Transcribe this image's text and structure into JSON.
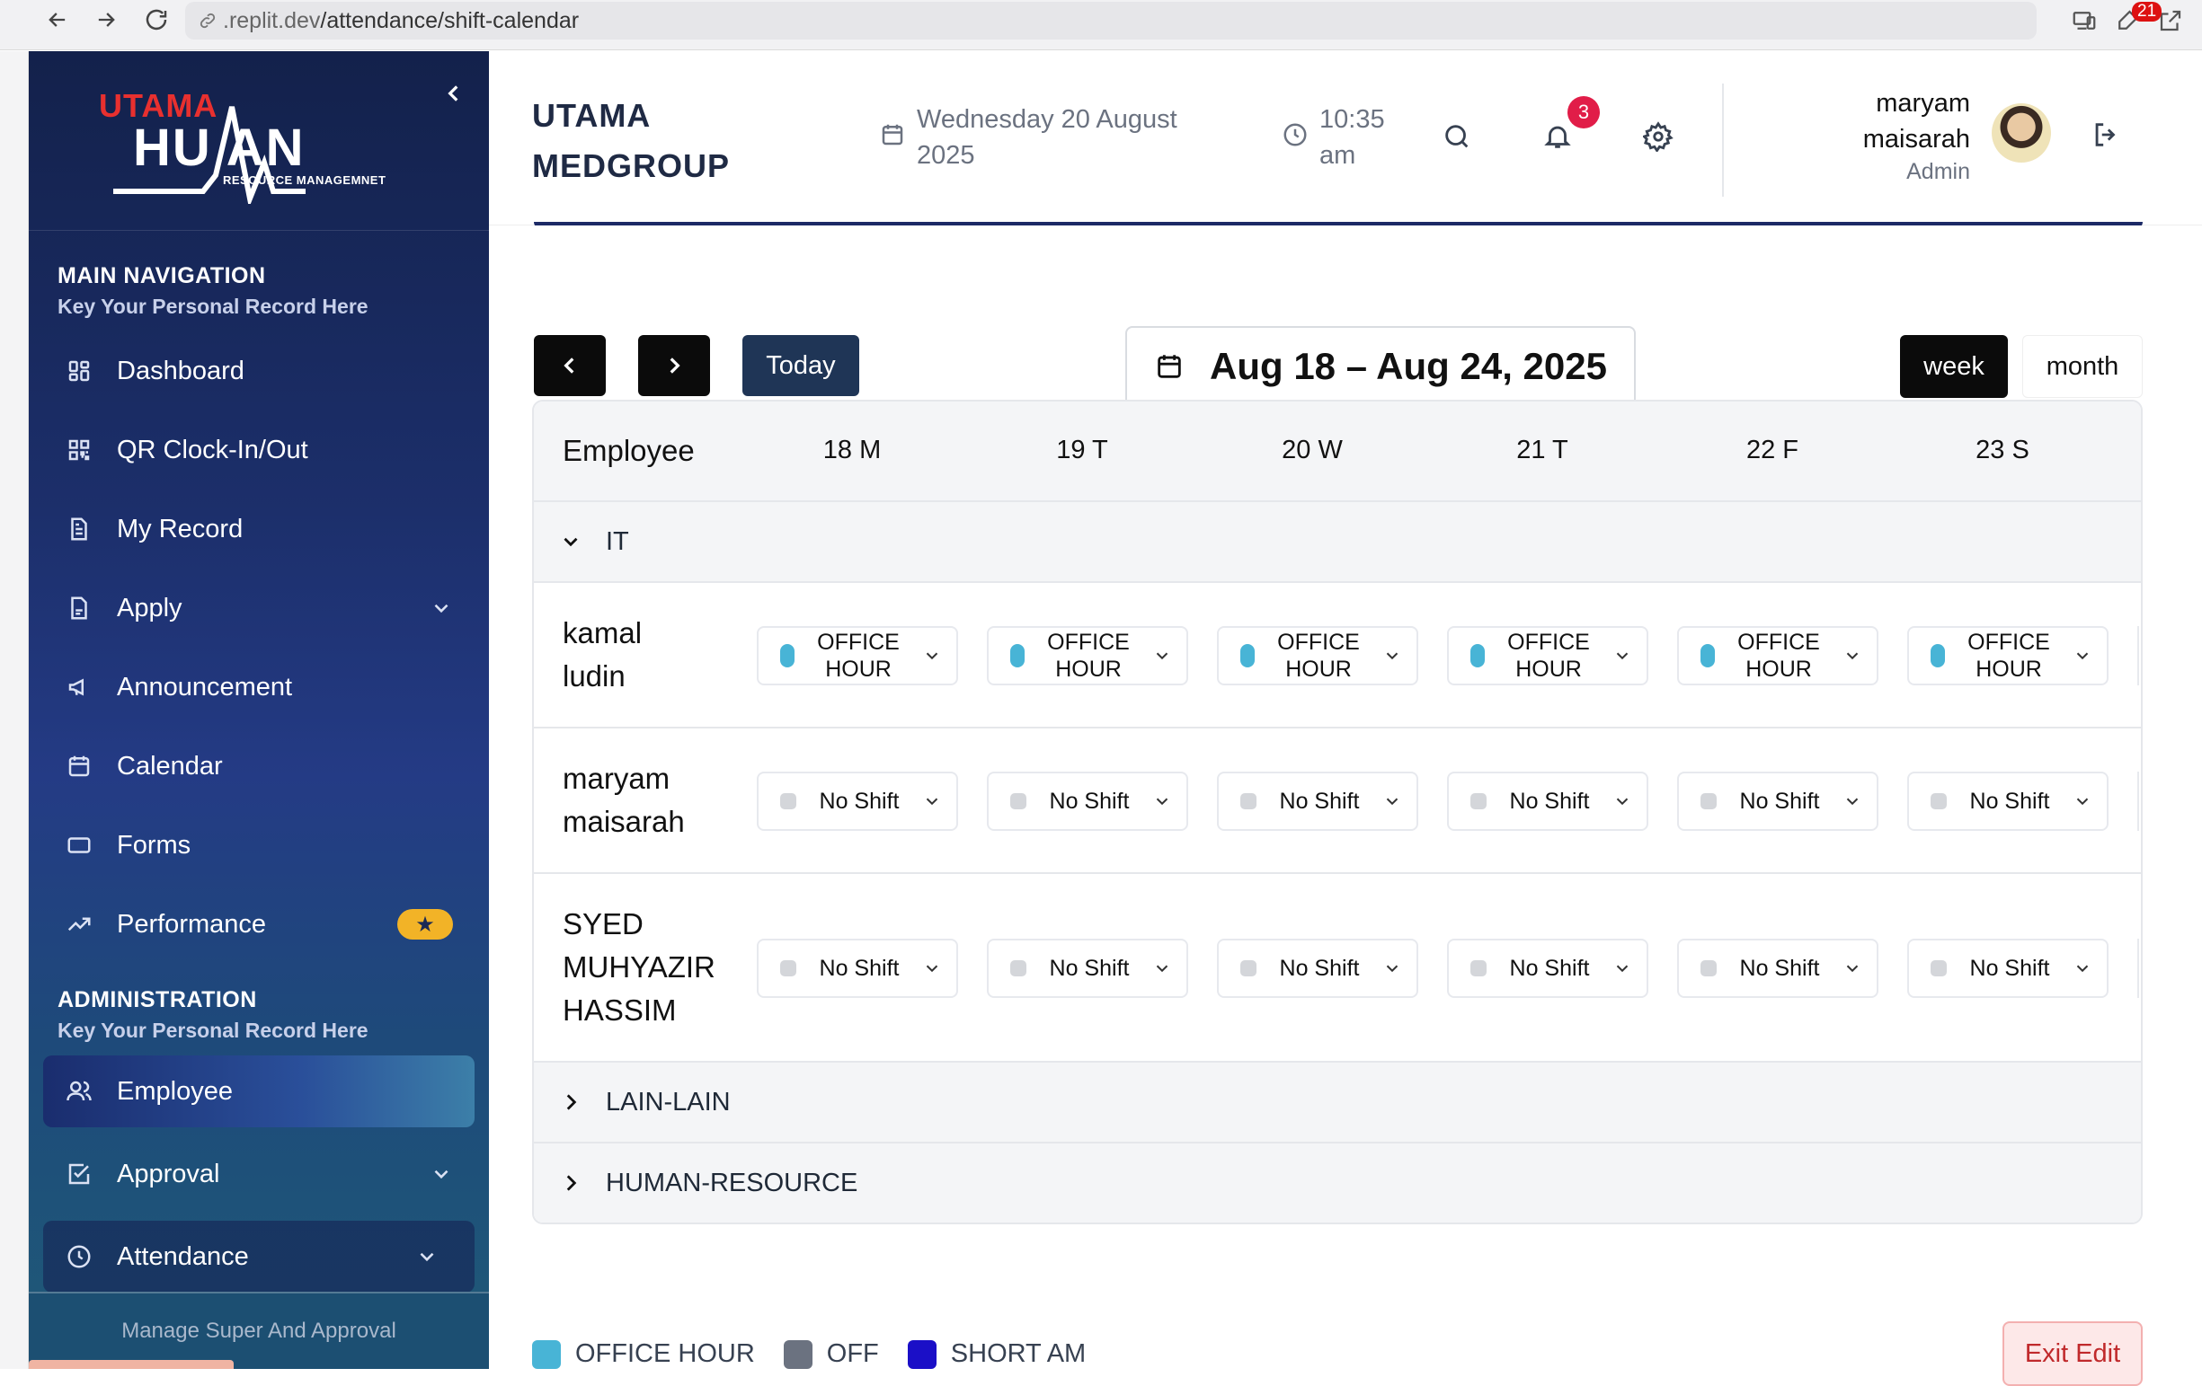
{
  "browser": {
    "url_prefix": ".replit.dev",
    "url_path": "/attendance/shift-calendar",
    "ext_badge": "21"
  },
  "sidebar": {
    "logo": {
      "utama": "UTAMA",
      "human": "HU  AN",
      "tagline": "RESOURCE MANAGEMNET"
    },
    "main_nav": {
      "title": "MAIN NAVIGATION",
      "subtitle": "Key Your Personal Record Here"
    },
    "items": [
      {
        "label": "Dashboard",
        "icon": "dashboard-icon"
      },
      {
        "label": "QR Clock-In/Out",
        "icon": "qr-icon"
      },
      {
        "label": "My Record",
        "icon": "document-icon"
      },
      {
        "label": "Apply",
        "icon": "file-icon"
      },
      {
        "label": "Announcement",
        "icon": "megaphone-icon"
      },
      {
        "label": "Calendar",
        "icon": "calendar-icon"
      },
      {
        "label": "Forms",
        "icon": "form-icon"
      },
      {
        "label": "Performance",
        "icon": "trend-icon"
      }
    ],
    "admin_nav": {
      "title": "ADMINISTRATION",
      "subtitle": "Key Your Personal Record Here"
    },
    "admin_items": [
      {
        "label": "Employee",
        "icon": "users-icon"
      },
      {
        "label": "Approval",
        "icon": "check-square-icon"
      },
      {
        "label": "Attendance",
        "icon": "clock-icon"
      }
    ],
    "footer": "Manage Super And Approval"
  },
  "header": {
    "brand_line1": "UTAMA",
    "brand_line2": "MEDGROUP",
    "date_line1": "Wednesday 20 August",
    "date_line2": "2025",
    "time_line1": "10:35",
    "time_line2": "am",
    "notification_count": "3",
    "user_first": "maryam",
    "user_last": "maisarah",
    "user_role": "Admin"
  },
  "toolbar": {
    "today_label": "Today",
    "range_label": "Aug 18 – Aug 24, 2025",
    "week_label": "week",
    "month_label": "month"
  },
  "calendar": {
    "employee_header": "Employee",
    "days": [
      "18 M",
      "19 T",
      "20 W",
      "21 T",
      "22 F",
      "23 S"
    ],
    "groups": [
      {
        "name": "IT",
        "expanded": true
      },
      {
        "name": "LAIN-LAIN",
        "expanded": false
      },
      {
        "name": "HUMAN-RESOURCE",
        "expanded": false
      }
    ],
    "rows": [
      {
        "name_line1": "kamal",
        "name_line2": "ludin",
        "name_line3": "",
        "shift_line1": "OFFICE",
        "shift_line2": "HOUR",
        "type": "office"
      },
      {
        "name_line1": "maryam",
        "name_line2": "maisarah",
        "name_line3": "",
        "shift_line1": "No Shift",
        "shift_line2": "",
        "type": "none"
      },
      {
        "name_line1": "SYED",
        "name_line2": "MUHYAZIR",
        "name_line3": "HASSIM",
        "shift_line1": "No Shift",
        "shift_line2": "",
        "type": "none"
      }
    ]
  },
  "legend": [
    {
      "label": "OFFICE HOUR",
      "color": "#48b4d6"
    },
    {
      "label": "OFF",
      "color": "#6b7280"
    },
    {
      "label": "SHORT AM",
      "color": "#1b0fc7"
    }
  ],
  "exit_edit_label": "Exit Edit",
  "colors": {
    "sidebar_top": "#13214b",
    "sidebar_bottom": "#1f5a78",
    "accent_red": "#e11d48"
  }
}
